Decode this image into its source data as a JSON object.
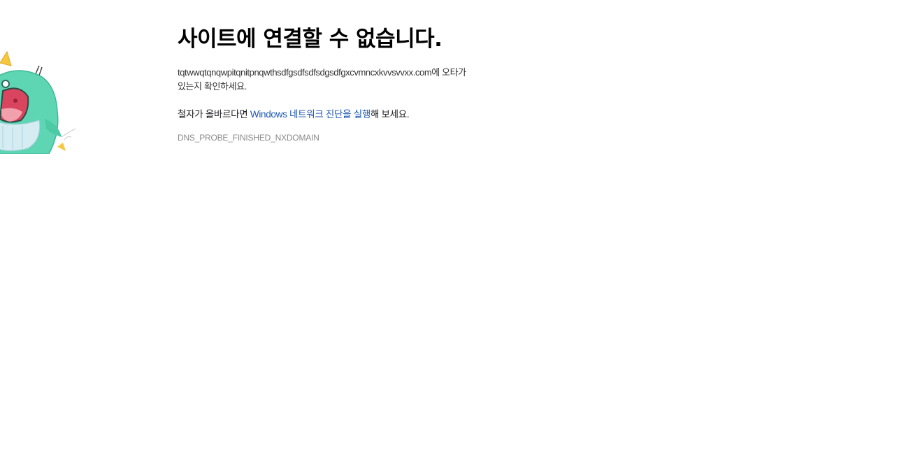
{
  "error": {
    "title": "사이트에 연결할 수 없습니다.",
    "domain": "tqtwwqtqnqwpitqnitpnqwthsdfgsdfsdfsdgsdfgxcvmncxkvvsvvxx.com",
    "typo_suffix": "에 오타가 있는지 확인하세요.",
    "suggestion_prefix": "철자가 올바르다면 ",
    "suggestion_link": "Windows 네트워크 진단을 실행",
    "suggestion_suffix": "해 보세요.",
    "error_code": "DNS_PROBE_FINISHED_NXDOMAIN"
  },
  "colors": {
    "link": "#1a55b3",
    "mascot_body": "#5ed6b4",
    "mascot_mouth": "#d9455f"
  },
  "icons": {
    "mascot": "screaming-whale-mascot"
  }
}
